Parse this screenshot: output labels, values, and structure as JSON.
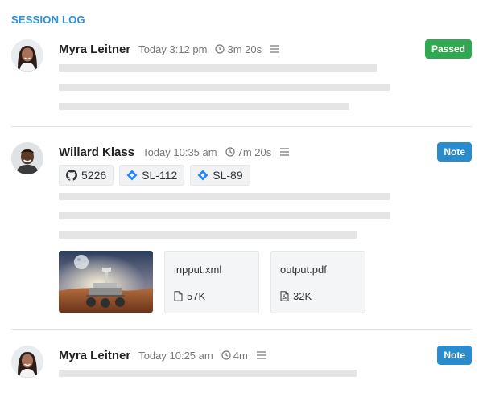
{
  "section": {
    "title": "SESSION LOG"
  },
  "entries": [
    {
      "name": "Myra Leitner",
      "time": "Today 3:12 pm",
      "duration": "3m 20s",
      "badge": "Passed",
      "badge_color": "#2fa84f"
    },
    {
      "name": "Willard Klass",
      "time": "Today 10:35 am",
      "duration": "7m 20s",
      "badge": "Note",
      "badge_color": "#2a8bcf",
      "tags": [
        {
          "icon": "github-icon",
          "label": "5226"
        },
        {
          "icon": "jira-icon",
          "label": "SL-112"
        },
        {
          "icon": "jira-icon",
          "label": "SL-89"
        }
      ],
      "attachments": [
        {
          "type": "image",
          "icon": "mars-rover-image"
        },
        {
          "type": "file",
          "name": "inpput.xml",
          "size": "57K",
          "icon": "file-icon"
        },
        {
          "type": "file",
          "name": "output.pdf",
          "size": "32K",
          "icon": "pdf-file-icon"
        }
      ]
    },
    {
      "name": "Myra Leitner",
      "time": "Today 10:25 am",
      "duration": "4m",
      "badge": "Note",
      "badge_color": "#2a8bcf"
    }
  ],
  "colors": {
    "accent": "#2d8fd5",
    "passed": "#2fa84f",
    "note": "#2a8bcf",
    "placeholder_line": "#e5e5e5"
  }
}
